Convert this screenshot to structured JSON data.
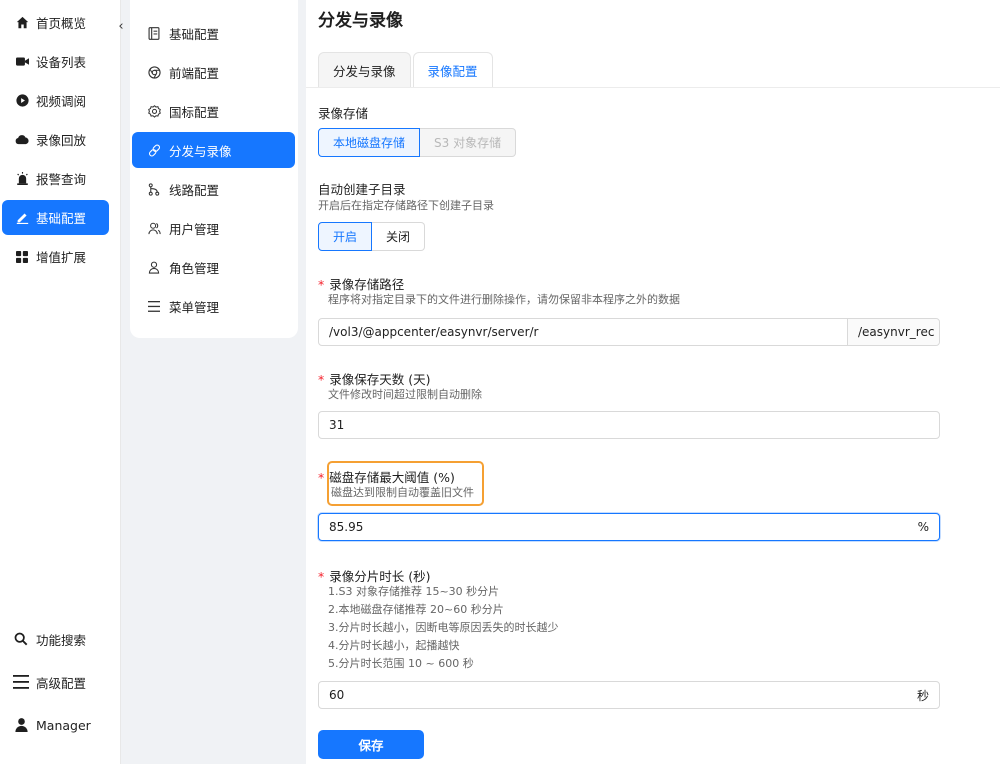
{
  "nav": {
    "items": [
      {
        "label": "首页概览",
        "icon": "home-icon"
      },
      {
        "label": "设备列表",
        "icon": "camera-icon"
      },
      {
        "label": "视频调阅",
        "icon": "play-circle-icon"
      },
      {
        "label": "录像回放",
        "icon": "cloud-icon"
      },
      {
        "label": "报警查询",
        "icon": "alarm-icon"
      },
      {
        "label": "基础配置",
        "icon": "edit-icon",
        "active": true
      },
      {
        "label": "增值扩展",
        "icon": "grid-icon"
      }
    ],
    "bottom": [
      {
        "label": "功能搜索",
        "icon": "search-icon"
      },
      {
        "label": "高级配置",
        "icon": "menu-icon"
      },
      {
        "label": "Manager",
        "icon": "user-icon"
      }
    ]
  },
  "submenu": {
    "items": [
      {
        "label": "基础配置",
        "icon": "document-icon"
      },
      {
        "label": "前端配置",
        "icon": "chrome-icon"
      },
      {
        "label": "国标配置",
        "icon": "gear-icon"
      },
      {
        "label": "分发与录像",
        "icon": "link-icon",
        "active": true
      },
      {
        "label": "线路配置",
        "icon": "branch-icon"
      },
      {
        "label": "用户管理",
        "icon": "users-icon"
      },
      {
        "label": "角色管理",
        "icon": "person-icon"
      },
      {
        "label": "菜单管理",
        "icon": "list-icon"
      }
    ]
  },
  "page": {
    "title": "分发与录像",
    "tabs": [
      {
        "label": "分发与录像",
        "active": false
      },
      {
        "label": "录像配置",
        "active": true
      }
    ]
  },
  "form": {
    "storage": {
      "label": "录像存储",
      "options": [
        "本地磁盘存储",
        "S3 对象存储"
      ],
      "selected": "本地磁盘存储"
    },
    "auto_subdir": {
      "label": "自动创建子目录",
      "hint": "开启后在指定存储路径下创建子目录",
      "options": [
        "开启",
        "关闭"
      ],
      "selected": "开启"
    },
    "path": {
      "required_mark": "*",
      "label": "录像存储路径",
      "hint": "程序将对指定目录下的文件进行删除操作，请勿保留非本程序之外的数据",
      "value": "/vol3/@appcenter/easynvr/server/r",
      "addon": "/easynvr_rec"
    },
    "retention": {
      "required_mark": "*",
      "label": "录像保存天数 (天)",
      "hint": "文件修改时间超过限制自动删除",
      "value": "31"
    },
    "threshold": {
      "required_mark": "*",
      "label": "磁盘存储最大阈值 (%)",
      "hint": "磁盘达到限制自动覆盖旧文件",
      "value": "85.95",
      "suffix": "%"
    },
    "segment": {
      "required_mark": "*",
      "label": "录像分片时长 (秒)",
      "hints": [
        "1.S3 对象存储推荐 15~30 秒分片",
        "2.本地磁盘存储推荐 20~60 秒分片",
        "3.分片时长越小，因断电等原因丢失的时长越少",
        "4.分片时长越小，起播越快",
        "5.分片时长范围 10 ~ 600 秒"
      ],
      "value": "60",
      "suffix": "秒"
    },
    "save_label": "保存"
  },
  "colors": {
    "primary": "#1677ff",
    "highlight": "#f5a033",
    "required": "#f5222d"
  }
}
